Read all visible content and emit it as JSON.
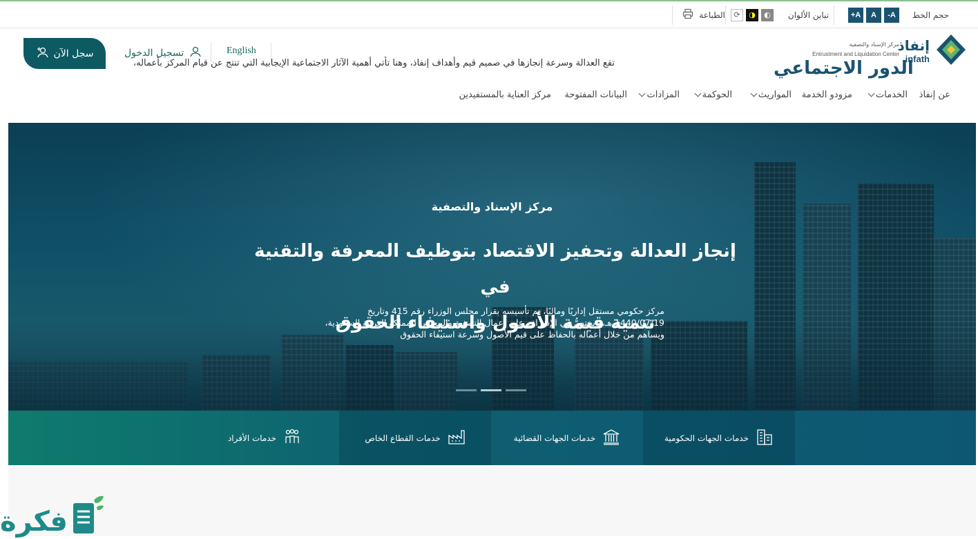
{
  "utility": {
    "font_size_label": "حجم الخط",
    "font_buttons": [
      "A+",
      "A",
      "A-"
    ],
    "contrast_label": "تباين الألوان",
    "print_label": "الطباعة"
  },
  "logo": {
    "name_ar": "إنفاذ",
    "name_en": "infath",
    "subtitle_ar": "مركز الإسناد والتصفية",
    "subtitle_en": "Entrustment and Liquidation Center"
  },
  "header": {
    "register_label": "سجل الآن",
    "login_label": "تسجيل الدخول",
    "language_label": "English"
  },
  "nav": {
    "items": [
      {
        "label": "عن إنفاذ",
        "dropdown": false
      },
      {
        "label": "الخدمات",
        "dropdown": true
      },
      {
        "label": "مزودو الخدمة",
        "dropdown": false
      },
      {
        "label": "المواريث",
        "dropdown": true
      },
      {
        "label": "الحوكمة",
        "dropdown": true
      },
      {
        "label": "المزادات",
        "dropdown": true
      },
      {
        "label": "البيانات المفتوحة",
        "dropdown": false
      },
      {
        "label": "مركز العناية بالمستفيدين",
        "dropdown": false
      }
    ]
  },
  "hero": {
    "subtitle": "مركز الإسناد والتصفية",
    "title_line1": "إنجاز العدالة وتحفيز الاقتصاد بتوظيف المعرفة والتقنية في",
    "title_line2": "تنمية قيمة الأصول واستيفاء الحقوق",
    "desc_line1": "مركز حكومي مستقل إداريًا وماليًا، تم تأسيسه بقرار مجلس الوزراء رقم 415 وتاريخ",
    "desc_line2": "1440/07/19 هـ، ويختصُّ في الإشراف على أعمال التصفية والبيع في المملكة العربية السعودية،",
    "desc_line3": "ويساهم من خلال أعماله بالحفاظ على قيم الأصول وسرعة استيفاء الحقوق",
    "slides": 3,
    "active_slide": 2
  },
  "services": {
    "items": [
      {
        "label": "خدمات الجهات الحكومية",
        "icon": "government-building-icon"
      },
      {
        "label": "خدمات الجهات القضائية",
        "icon": "courthouse-icon"
      },
      {
        "label": "خدمات القطاع الخاص",
        "icon": "factory-icon"
      },
      {
        "label": "خدمات الأفراد",
        "icon": "people-icon"
      }
    ]
  },
  "lower": {
    "heading": "الدور الاجتماعي",
    "text": "تقع العدالة وسرعة إنجازها في صميم قيم وأهداف إنفاذ، وهنا تأتي أهمية الآثار الاجتماعية الإيجابية التي تنتج عن قيام المركز بأعماله،"
  },
  "watermark": {
    "text": "فكرة"
  },
  "colors": {
    "primary": "#1a5370",
    "accent": "#0e5a63",
    "services_start": "#0f7b6d",
    "services_end": "#0d5772"
  }
}
